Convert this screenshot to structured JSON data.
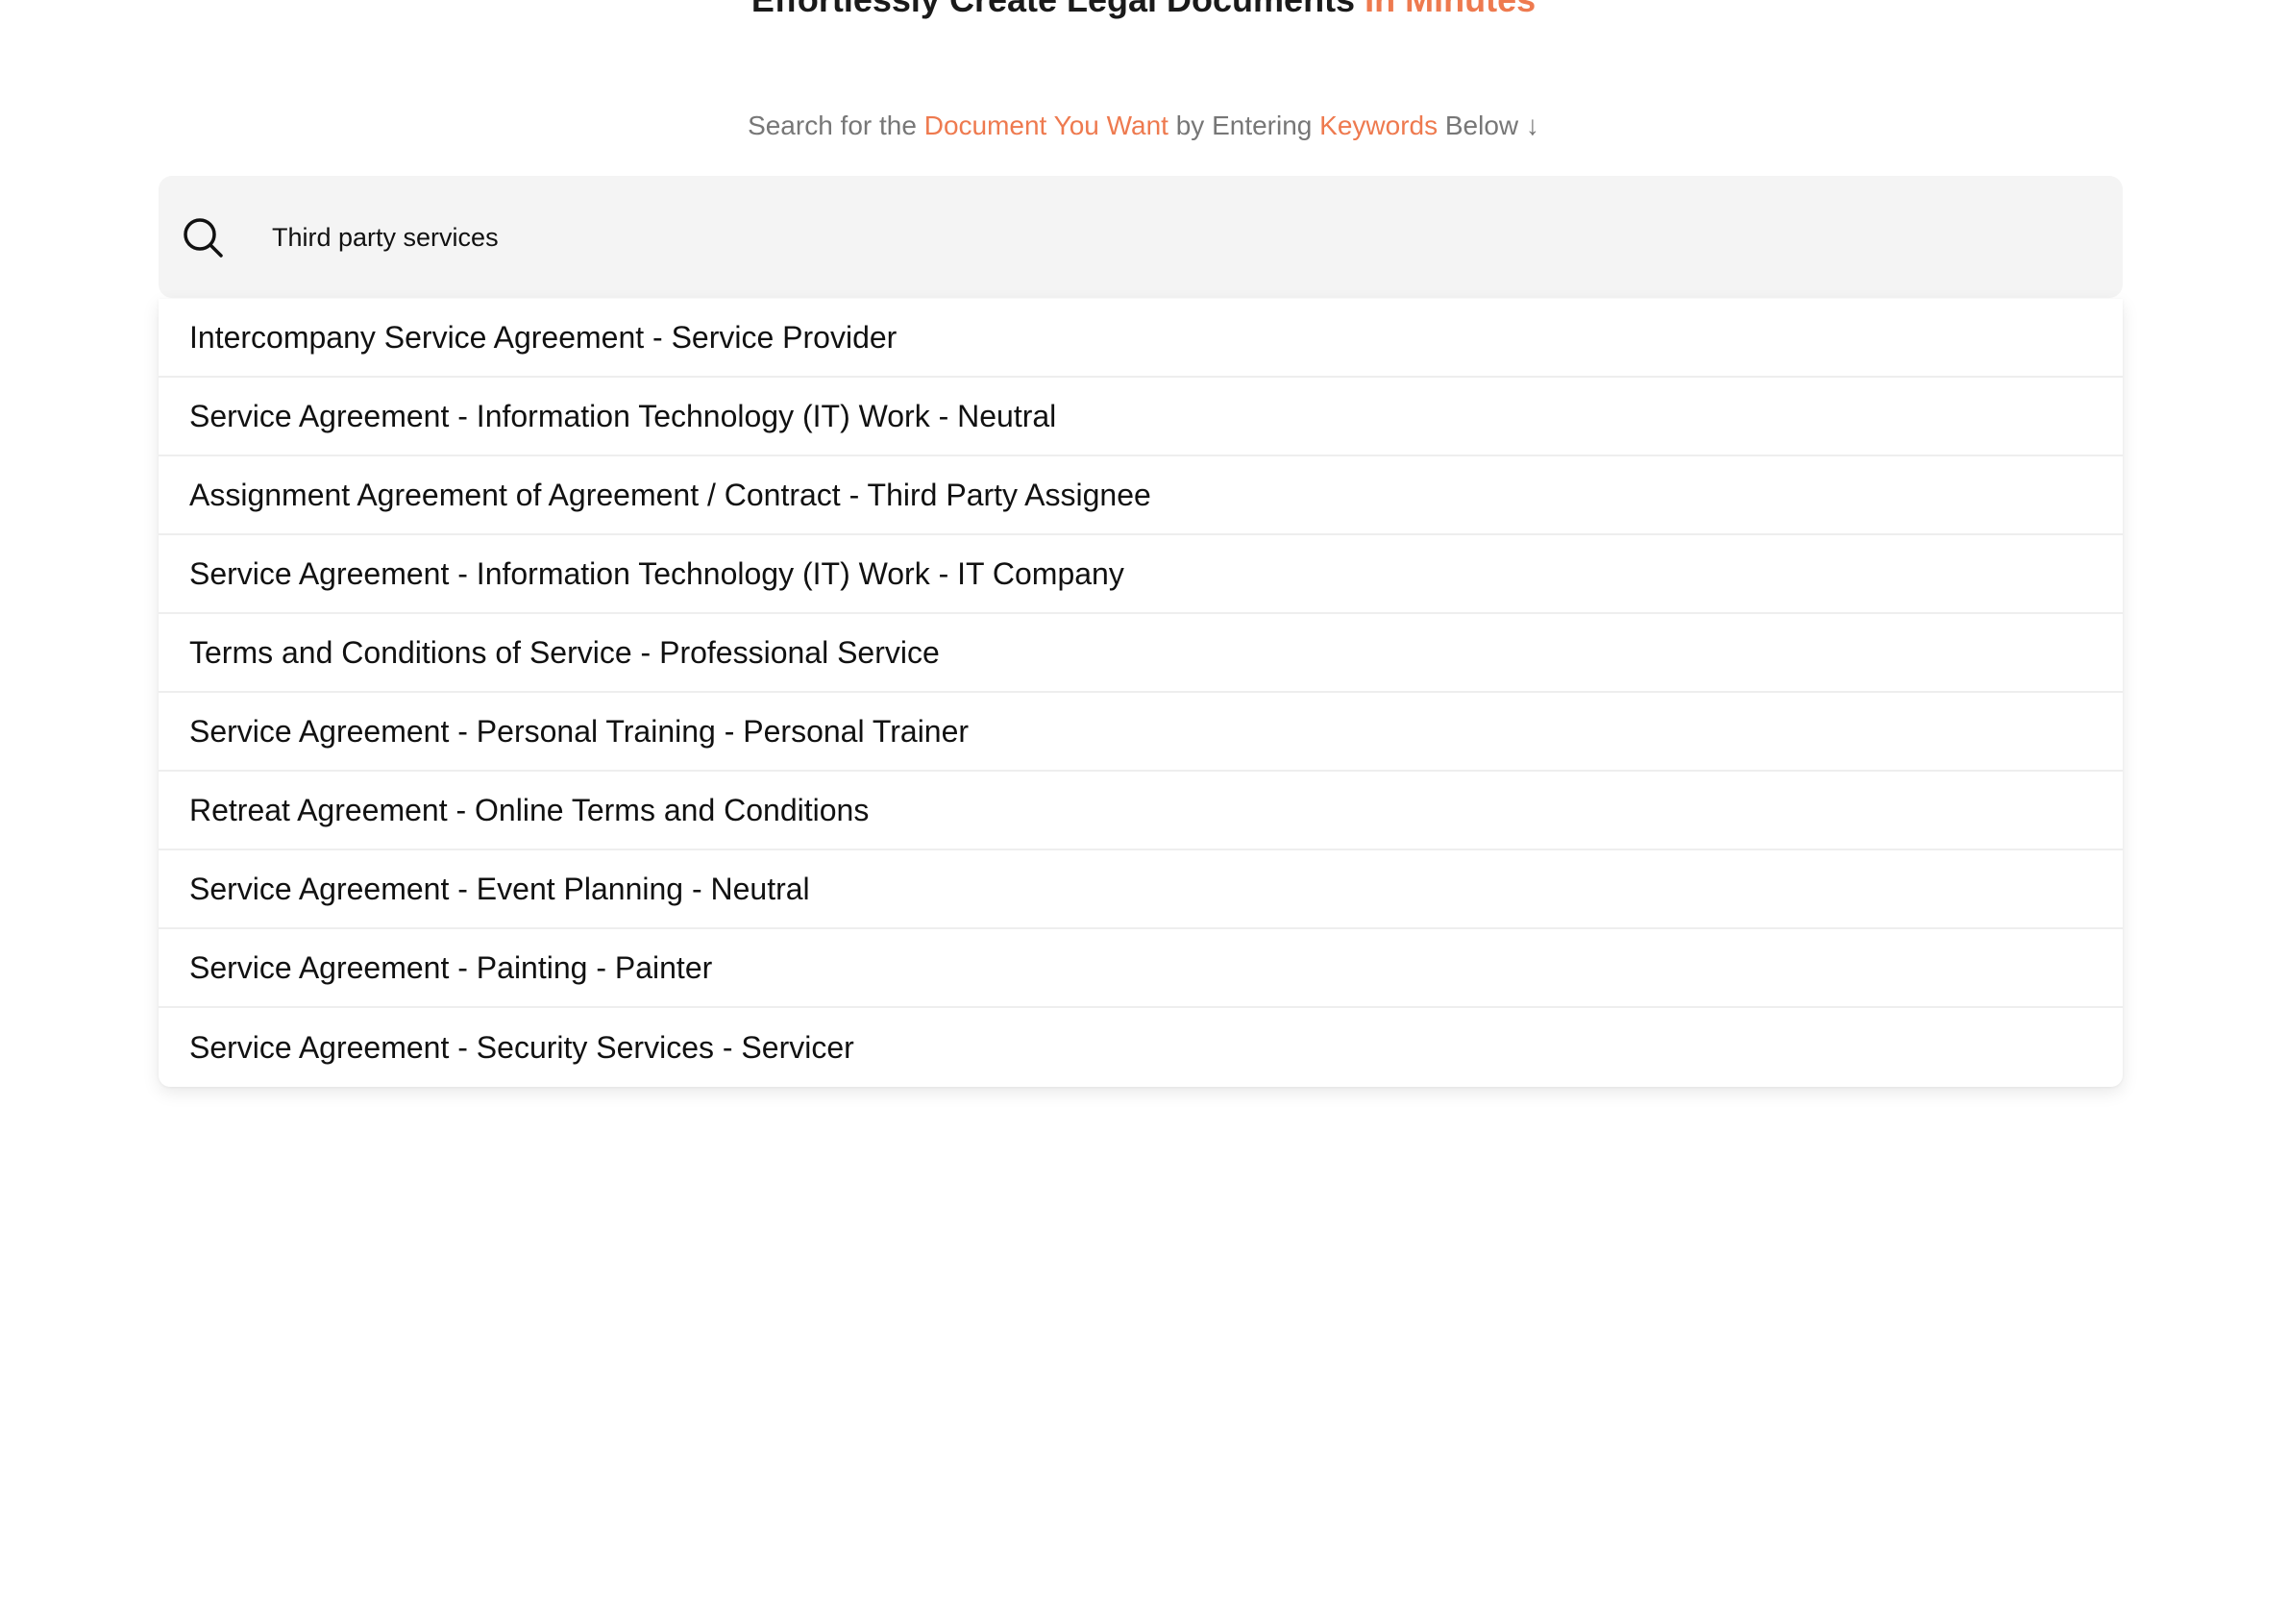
{
  "headline": {
    "prefix": "Effortlessly Create Legal Documents",
    "accent": "In Minutes"
  },
  "subheading": {
    "part1": "Search for the",
    "accent1": "Document You Want",
    "part2": "by Entering",
    "accent2": "Keywords",
    "part3": "Below ↓"
  },
  "search": {
    "value": "Third party services",
    "icon": "search-icon"
  },
  "colors": {
    "accent": "#ee7a4f",
    "search_bg": "#f4f4f4"
  },
  "results": [
    "Intercompany Service Agreement - Service Provider",
    "Service Agreement - Information Technology (IT) Work - Neutral",
    "Assignment Agreement of Agreement / Contract - Third Party Assignee",
    "Service Agreement - Information Technology (IT) Work - IT Company",
    "Terms and Conditions of Service - Professional Service",
    "Service Agreement - Personal Training - Personal Trainer",
    "Retreat Agreement - Online Terms and Conditions",
    "Service Agreement - Event Planning - Neutral",
    "Service Agreement - Painting - Painter",
    "Service Agreement - Security Services - Servicer"
  ]
}
